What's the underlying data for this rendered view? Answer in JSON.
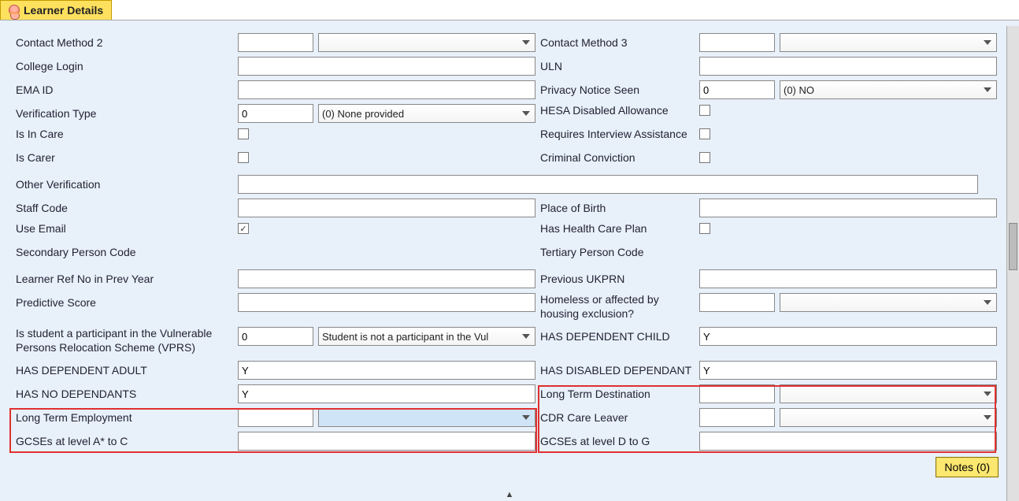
{
  "tab_title": "Learner Details",
  "left": {
    "contact_method_2": "Contact Method 2",
    "college_login": "College Login",
    "ema_id": "EMA ID",
    "verification_type": "Verification Type",
    "verification_type_val": "0",
    "verification_type_dd": "(0) None provided",
    "is_in_care": "Is In Care",
    "is_carer": "Is Carer",
    "other_verification": "Other Verification",
    "staff_code": "Staff Code",
    "use_email": "Use Email",
    "secondary_person_code": "Secondary Person Code",
    "learner_ref_prev": "Learner Ref No in Prev Year",
    "predictive_score": "Predictive Score",
    "vprs": "Is student a participant in the Vulnerable Persons Relocation Scheme (VPRS)",
    "vprs_val": "0",
    "vprs_dd": "Student is not a participant in the Vul",
    "has_dep_adult": "HAS DEPENDENT ADULT",
    "has_dep_adult_val": "Y",
    "has_no_dep": "HAS NO DEPENDANTS",
    "has_no_dep_val": "Y",
    "long_term_emp": "Long Term Employment",
    "gcse_a_c": "GCSEs at level A* to C"
  },
  "right": {
    "contact_method_3": "Contact Method 3",
    "uln": "ULN",
    "privacy_notice": "Privacy Notice Seen",
    "privacy_notice_val": "0",
    "privacy_notice_dd": "(0) NO",
    "hesa_disabled": "HESA Disabled Allowance",
    "interview_assist": "Requires Interview Assistance",
    "criminal": "Criminal Conviction",
    "place_birth": "Place of Birth",
    "health_care": "Has Health Care Plan",
    "tertiary_person": "Tertiary Person Code",
    "prev_ukprn": "Previous UKPRN",
    "homeless": "Homeless or affected by housing exclusion?",
    "has_dep_child": "HAS DEPENDENT CHILD",
    "has_dep_child_val": "Y",
    "has_disabled_dep": "HAS DISABLED DEPENDANT",
    "has_disabled_dep_val": "Y",
    "long_term_dest": "Long Term Destination",
    "cdr_care": "CDR Care Leaver",
    "gcse_d_g": "GCSEs at level D to G"
  },
  "notes_button": "Notes (0)"
}
